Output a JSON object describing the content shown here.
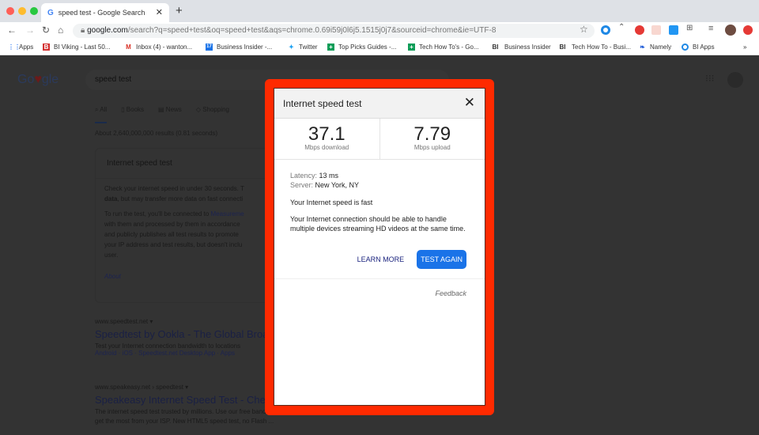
{
  "browser": {
    "tab_title": "speed test - Google Search",
    "url_domain": "google.com",
    "url_path": "/search?q=speed+test&oq=speed+test&aqs=chrome.0.69i59j0l6j5.1515j0j7&sourceid=chrome&ie=UTF-8",
    "bookmarks": [
      {
        "label": "Apps",
        "icon": "apps-grid-icon"
      },
      {
        "label": "BI Viking - Last 50...",
        "icon": "bi-icon"
      },
      {
        "label": "Inbox (4) - wanton...",
        "icon": "gmail-icon"
      },
      {
        "label": "Business Insider -...",
        "icon": "calendar-icon"
      },
      {
        "label": "Twitter",
        "icon": "twitter-icon"
      },
      {
        "label": "Top Picks Guides -...",
        "icon": "sheets-icon"
      },
      {
        "label": "Tech How To's - Go...",
        "icon": "sheets-icon"
      },
      {
        "label": "Business Insider",
        "icon": "bi-text-icon"
      },
      {
        "label": "Tech How To - Busi...",
        "icon": "bi-text-icon"
      },
      {
        "label": "Namely",
        "icon": "namely-icon"
      },
      {
        "label": "BI Apps",
        "icon": "circle-icon"
      }
    ],
    "more_bookmarks": "»"
  },
  "google": {
    "logo": "Go gle",
    "query": "speed test",
    "tabs": [
      "All",
      "Books",
      "News",
      "Shopping"
    ],
    "stats": "About 2,640,000,000 results (0.81 seconds)",
    "card": {
      "title": "Internet speed test",
      "p1a": "Check your internet speed in under 30 seconds. T",
      "p1b": "data",
      "p1c": ", but may transfer more data on fast connecti",
      "p2a": "To run the test, you'll be connected to ",
      "p2link": "Measureme",
      "p2b": "with them and processed by them in accordance",
      "p2c": "and publicly publishes all test results to promote",
      "p2d": "your IP address and test results, but doesn't inclu",
      "p2e": "user.",
      "about": "About"
    },
    "results": [
      {
        "site": "www.speedtest.net",
        "title": "Speedtest by Ookla - The Global Broa",
        "snippet": "Test your Internet connection bandwidth to locations",
        "links": "Android · iOS · Speedtest.net Desktop App · Apps"
      },
      {
        "site": "www.speakeasy.net › speedtest",
        "title": "Speakeasy Internet Speed Test - Che",
        "snippet": "The internet speed test trusted by millions. Use our free bandwidth test to check your speed and",
        "snippet2": "get the most from your ISP. New HTML5 speed test, no Flash ..."
      }
    ]
  },
  "dialog": {
    "title": "Internet speed test",
    "download_value": "37.1",
    "download_label": "Mbps download",
    "upload_value": "7.79",
    "upload_label": "Mbps upload",
    "latency_label": "Latency:",
    "latency_value": "13 ms",
    "server_label": "Server:",
    "server_value": "New York, NY",
    "verdict": "Your Internet speed is fast",
    "description": "Your Internet connection should be able to handle multiple devices streaming HD videos at the same time.",
    "learn_more": "LEARN MORE",
    "test_again": "TEST AGAIN",
    "feedback": "Feedback",
    "highlight_color": "#ff2a00",
    "button_color": "#1a73e8"
  }
}
